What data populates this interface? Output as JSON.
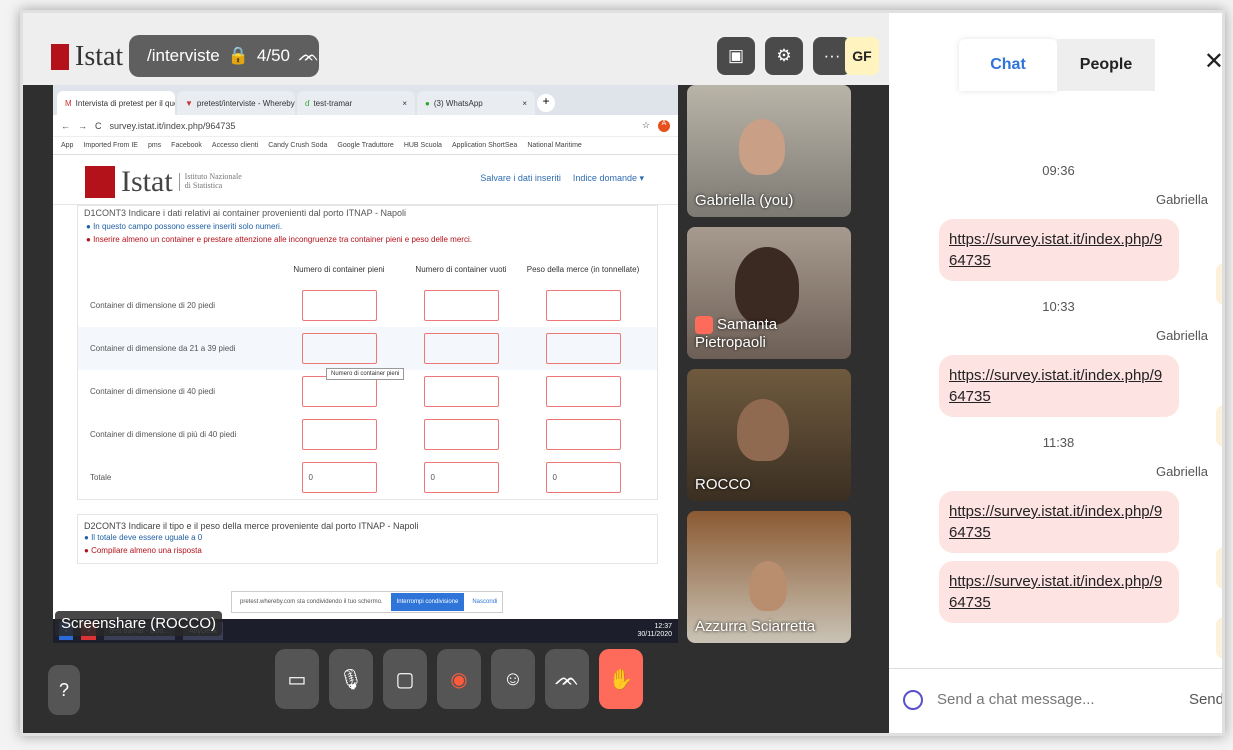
{
  "whereby": {
    "logo_text": "Istat",
    "room_name": "/interviste",
    "participant_count": "4/50",
    "avatar_initials": "GF",
    "screenshare_label": "Screenshare (ROCCO)",
    "help_label": "?"
  },
  "browser": {
    "tabs": [
      {
        "label": "Intervista di pretest per il questi",
        "active": true
      },
      {
        "label": "pretest/interviste - Whereby",
        "active": false
      },
      {
        "label": "test-tramar",
        "active": false
      },
      {
        "label": "(3) WhatsApp",
        "active": false
      }
    ],
    "url": "survey.istat.it/index.php/964735",
    "bookmarks": [
      "App",
      "Imported From IE",
      "pms",
      "Facebook",
      "Accesso clienti",
      "Candy Crush Soda",
      "Google Traduttore",
      "HUB Scuola",
      "Application ShortSea",
      "National Maritime"
    ]
  },
  "survey": {
    "site_logo": "Istat",
    "site_sub_1": "Istituto Nazionale",
    "site_sub_2": "di Statistica",
    "link_save": "Salvare i dati inseriti",
    "link_index": "Indice domande ▾",
    "q1_title": "D1CONT3 Indicare i dati relativi ai container provenienti dal porto ITNAP - Napoli",
    "q1_info": "In questo campo possono essere inseriti solo numeri.",
    "q1_warn": "Inserire almeno un container e prestare attenzione alle incongruenze tra container pieni e peso delle merci.",
    "columns": [
      "Numero di container pieni",
      "Numero di container vuoti",
      "Peso della merce (in tonnellate)"
    ],
    "rows": [
      {
        "label": "Container di dimensione di 20 piedi",
        "values": [
          "",
          "",
          ""
        ]
      },
      {
        "label": "Container di dimensione da 21 a 39 piedi",
        "values": [
          "",
          "",
          ""
        ]
      },
      {
        "label": "Container di dimensione di 40 piedi",
        "values": [
          "",
          "",
          ""
        ]
      },
      {
        "label": "Container di dimensione di più di 40 piedi",
        "values": [
          "",
          "",
          ""
        ]
      },
      {
        "label": "Totale",
        "values": [
          "0",
          "0",
          "0"
        ]
      }
    ],
    "tooltip": "Numero di container pieni",
    "q2_title": "D2CONT3 Indicare il tipo e il peso della merce proveniente dal porto ITNAP - Napoli",
    "q2_info": "Il totale deve essere uguale a 0",
    "q2_warn": "Compilare almeno una risposta",
    "share_notice": "pretest.whereby.com sta condividendo il tuo schermo.",
    "share_stop": "Interrompi condivisione",
    "share_hide": "Nascondi"
  },
  "taskbar": {
    "items": [
      "test-tramar - Goo...",
      "AnyDesk"
    ],
    "time": "12:37",
    "date": "30/11/2020"
  },
  "participants": [
    {
      "name": "Gabriella (you)",
      "muted": false
    },
    {
      "name": "Samanta Pietropaoli",
      "muted": true
    },
    {
      "name": "ROCCO",
      "muted": false
    },
    {
      "name": "Azzurra Sciarretta",
      "muted": false
    }
  ],
  "chat": {
    "tab_chat": "Chat",
    "tab_people": "People",
    "messages": [
      {
        "time": "09:36",
        "sender": "Gabriella",
        "text": "https://survey.istat.it/index.php/964735"
      },
      {
        "time": "10:33",
        "sender": "Gabriella",
        "text": "https://survey.istat.it/index.php/964735"
      },
      {
        "time": "11:38",
        "sender": "Gabriella",
        "text": "https://survey.istat.it/index.php/964735"
      },
      {
        "time": "",
        "sender": "",
        "text": "https://survey.istat.it/index.php/964735"
      }
    ],
    "input_placeholder": "Send a chat message...",
    "send_label": "Send"
  }
}
